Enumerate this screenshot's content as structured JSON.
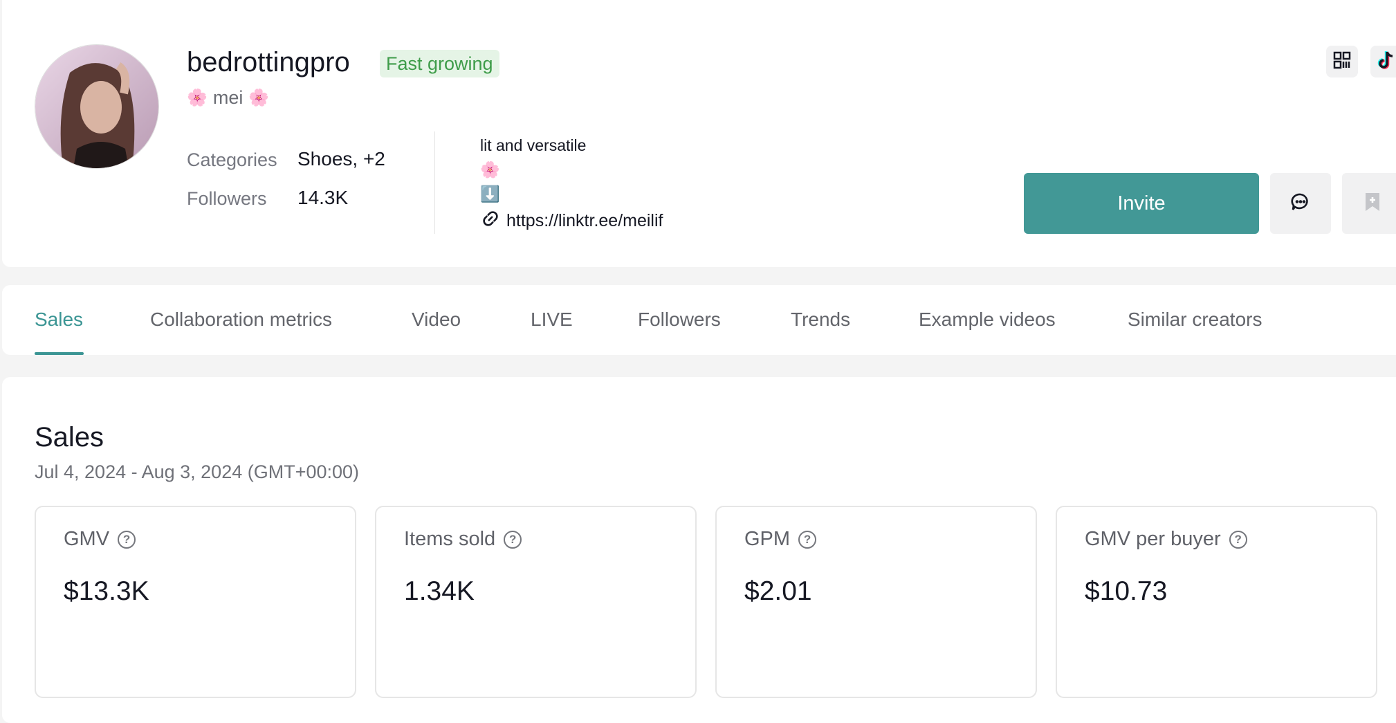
{
  "profile": {
    "username": "bedrottingpro",
    "badge": "Fast growing",
    "nickname": "mei",
    "nickname_flower": "🌸",
    "categories_label": "Categories",
    "categories_value": "Shoes, +2",
    "followers_label": "Followers",
    "followers_value": "14.3K",
    "bio_line1": "lit and versatile",
    "bio_emoji1": "🌸",
    "bio_emoji2": "⬇️",
    "bio_link": "https://linktr.ee/meilif",
    "invite_label": "Invite"
  },
  "tabs": [
    {
      "label": "Sales",
      "active": true
    },
    {
      "label": "Collaboration metrics"
    },
    {
      "label": "Video"
    },
    {
      "label": "LIVE"
    },
    {
      "label": "Followers"
    },
    {
      "label": "Trends"
    },
    {
      "label": "Example videos"
    },
    {
      "label": "Similar creators"
    }
  ],
  "sales": {
    "title": "Sales",
    "date_range": "Jul 4, 2024 - Aug 3, 2024 (GMT+00:00)",
    "metrics": [
      {
        "label": "GMV",
        "value": "$13.3K"
      },
      {
        "label": "Items sold",
        "value": "1.34K"
      },
      {
        "label": "GPM",
        "value": "$2.01"
      },
      {
        "label": "GMV per buyer",
        "value": "$10.73"
      }
    ]
  },
  "colors": {
    "accent": "#429896",
    "badge_bg": "#e5f4e6",
    "badge_text": "#3e9c49"
  },
  "icons": [
    "qr-code-icon",
    "tiktok-icon",
    "message-icon",
    "bookmark-icon",
    "link-icon",
    "help-icon"
  ]
}
